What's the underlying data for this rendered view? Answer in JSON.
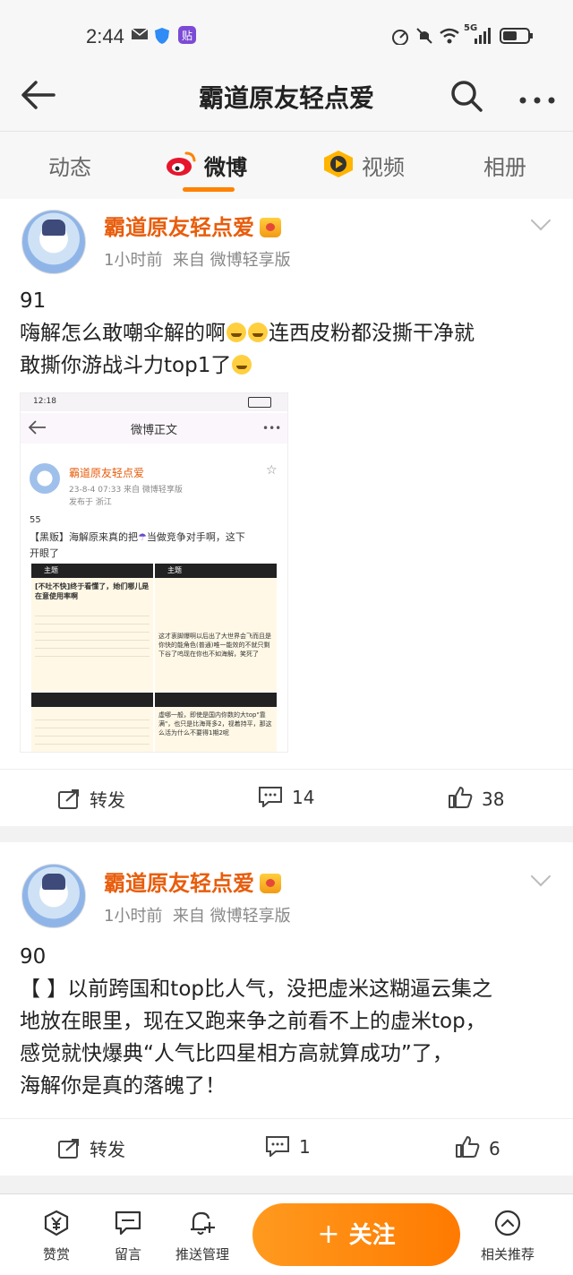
{
  "status": {
    "time": "2:44",
    "network": "5G"
  },
  "nav": {
    "title": "霸道原友轻点爱"
  },
  "tabs": [
    {
      "label": "动态"
    },
    {
      "label": "微博"
    },
    {
      "label": "视频"
    },
    {
      "label": "相册"
    }
  ],
  "posts": [
    {
      "username": "霸道原友轻点爱",
      "time": "1小时前",
      "source": "来自 微博轻享版",
      "number": "91",
      "line1": "嗨解怎么敢嘲伞解的啊",
      "line1b": "连西皮粉都没撕干净就",
      "line2": "敢撕你游战斗力top1了",
      "repost_label": "转发",
      "comments": "14",
      "likes": "38"
    },
    {
      "username": "霸道原友轻点爱",
      "time": "1小时前",
      "source": "来自 微博轻享版",
      "number": "90",
      "lines": [
        "【 】以前跨国和top比人气，没把虚米这糊逼云集之",
        "地放在眼里，现在又跑来争之前看不上的虚米top，",
        "感觉就快爆典“人气比四星相方高就算成功”了，",
        "海解你是真的落魄了！"
      ],
      "repost_label": "转发",
      "comments": "1",
      "likes": "6"
    }
  ],
  "embedded": {
    "time": "12:18",
    "title": "微博正文",
    "username": "霸道原友轻点爱",
    "meta": "23-8-4 07:33  来自 微博轻享版",
    "location": "发布于 浙江",
    "number": "55",
    "text1": "【黑贩】海解原来真的把",
    "text1b": "当做竞争对手啊，这下",
    "text2": "开眼了",
    "panel_title_a": "主题",
    "panel_title_b": "主题",
    "panel_a_head": "[不吐不快]终于看懂了，她们哪儿是在意使用率啊",
    "panel_b_text": "这才衷脚爆啊以后出了大世界会飞而且是你快的能角色(普通)唯一能效的不就只剩下谷了呜现在你也不如海解，笑死了",
    "panel_d_text": "虚哪一般，即使是国内你数的大top\"靠满\"，也只是比海哥多2，视着持平，那这么活为什么不要得1期2呢"
  },
  "bottom": {
    "reward": "赞赏",
    "message": "留言",
    "push": "推送管理",
    "follow": "关注",
    "related": "相关推荐"
  }
}
